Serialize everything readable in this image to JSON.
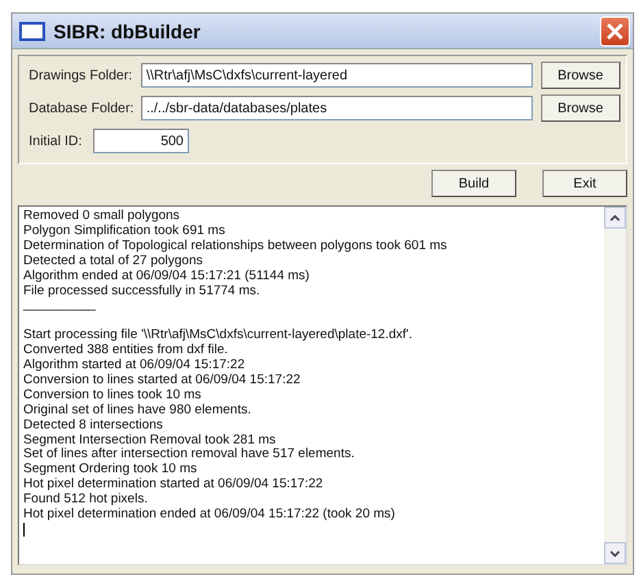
{
  "window": {
    "title": "SIBR: dbBuilder"
  },
  "fields": [
    {
      "label": "Drawings Folder:",
      "value": "\\\\Rtr\\afj\\MsC\\dxfs\\current-layered",
      "button": "Browse"
    },
    {
      "label": "Database Folder:",
      "value": "../../sbr-data/databases/plates",
      "button": "Browse"
    }
  ],
  "initial_id": {
    "label": "Initial ID:",
    "value": "500"
  },
  "actions": [
    "Build",
    "Exit"
  ],
  "log": {
    "blocks": [
      [
        "Removed 0 small polygons",
        "Polygon Simplification took 691 ms",
        "Determination of Topological relationships between polygons took 601 ms",
        "Detected a total of 27 polygons",
        "Algorithm ended at 06/09/04 15:17:21 (51144 ms)",
        "File processed successfully in 51774 ms.",
        "__________"
      ],
      [
        "Start processing file '\\\\Rtr\\afj\\MsC\\dxfs\\current-layered\\plate-12.dxf'.",
        "Converted 388 entities from dxf file.",
        "Algorithm started at 06/09/04 15:17:22",
        "Conversion to lines started at 06/09/04 15:17:22",
        "Conversion to lines took 10 ms",
        "Original set of lines have 980 elements.",
        "Detected 8 intersections",
        "Segment Intersection Removal took 281 ms",
        "Set of lines after intersection removal have 517 elements.",
        "Segment Ordering took 10 ms",
        "Hot pixel determination started at 06/09/04 15:17:22",
        "Found 512 hot pixels.",
        "Hot pixel determination ended at 06/09/04 15:17:22 (took 20 ms)"
      ]
    ]
  }
}
